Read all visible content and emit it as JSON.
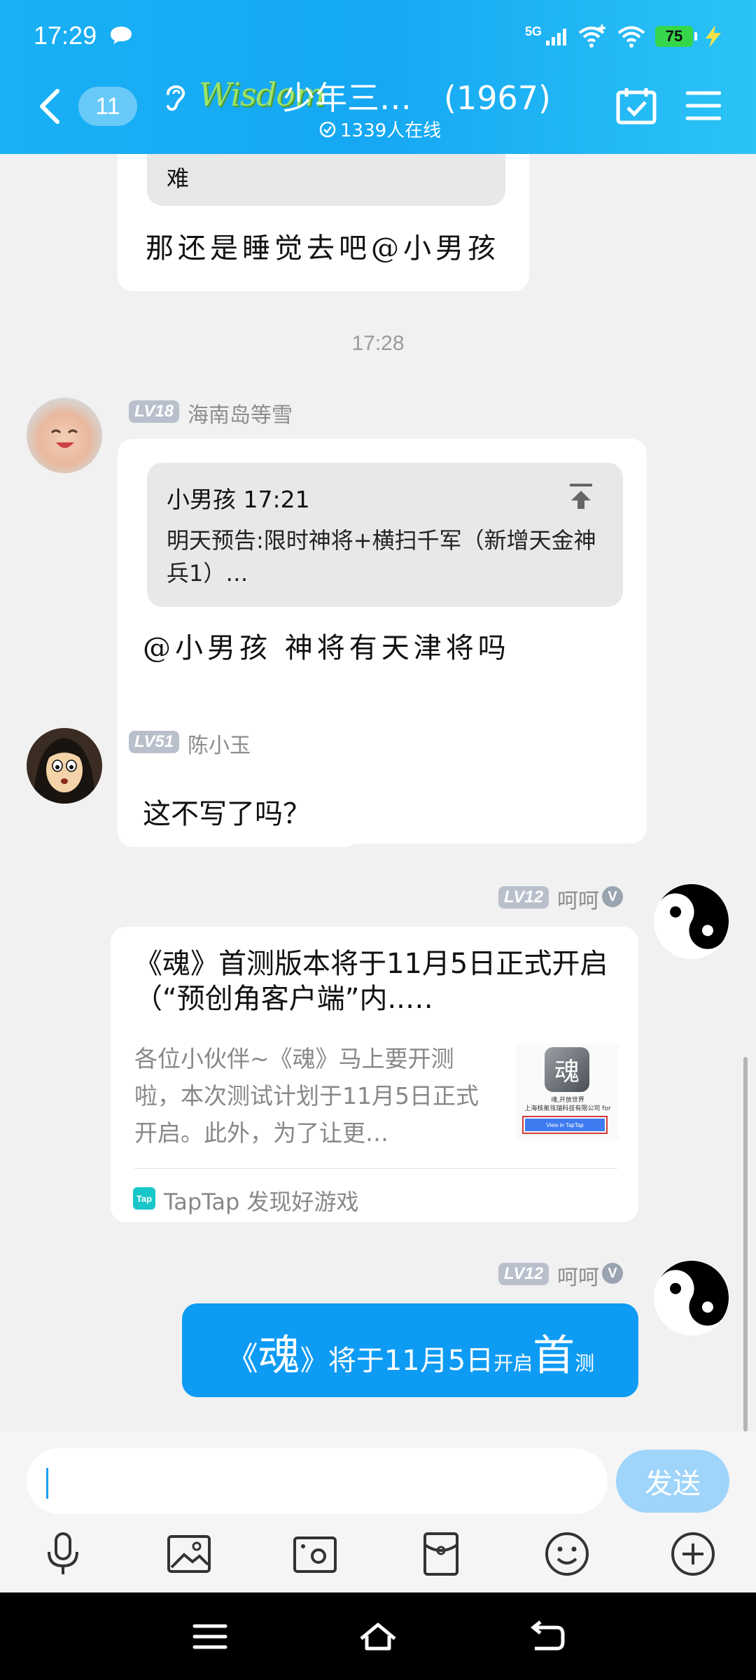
{
  "status_bar": {
    "time": "17:29",
    "network": "5G",
    "battery": "75"
  },
  "header": {
    "unread_count": "11",
    "group_logo_text": "Wisdom",
    "group_title": "少年三…　(1967)",
    "online_text": "1339人在线"
  },
  "messages": {
    "top": {
      "quote_tail": "难",
      "text": "那还是睡觉去吧@小男孩"
    },
    "timestamp": "17:28",
    "m1": {
      "level": "LV18",
      "sender": "海南岛等雪",
      "quote_header": "小男孩 17:21",
      "quote_body": "明天预告:限时神将+横扫千军（新增天金神兵1）…",
      "text": "@小男孩 神将有天津将吗"
    },
    "m2": {
      "level": "LV51",
      "sender": "陈小玉",
      "text": "这不写了吗？"
    },
    "m3": {
      "level": "LV12",
      "sender": "呵呵",
      "verified": "V",
      "card_title": "《魂》首测版本将于11月5日正式开启（“预创角客户端”内..…",
      "card_desc": "各位小伙伴~《魂》马上要开测啦，本次测试计划于11月5日正式开启。此外，为了让更…",
      "thumb_caption": "魂,开放世界",
      "thumb_company": "上海核氪瓴瑞科技有限公司 for",
      "thumb_button": "View in TapTap",
      "source_logo": "Tap",
      "source": "TapTap 发现好游戏"
    },
    "m4": {
      "level": "LV12",
      "sender": "呵呵",
      "verified": "V",
      "parts": [
        "《",
        "魂",
        "》将于11月5日",
        "开启",
        "首",
        "测"
      ]
    }
  },
  "input": {
    "placeholder": "",
    "send_label": "发送"
  },
  "toolbar_icons": [
    "microphone-icon",
    "image-icon",
    "camera-icon",
    "red-packet-icon",
    "emoji-icon",
    "plus-icon"
  ],
  "colors": {
    "accent": "#16a8f3",
    "send_disabled": "#9fd4fb",
    "outgoing_bubble": "#0e9bf3"
  }
}
